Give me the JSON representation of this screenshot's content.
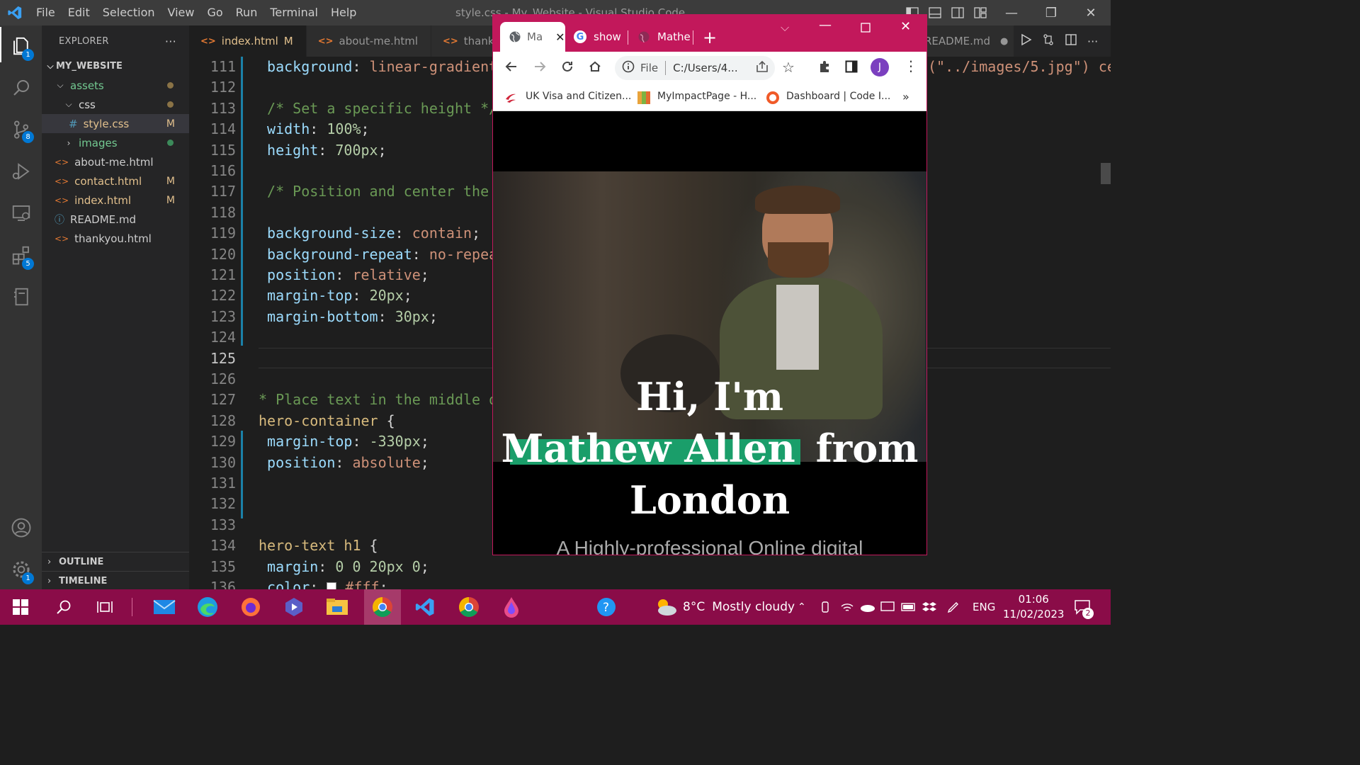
{
  "menubar": {
    "items": [
      "File",
      "Edit",
      "Selection",
      "View",
      "Go",
      "Run",
      "Terminal",
      "Help"
    ],
    "window_title": "style.css - My_Website - Visual Studio Code"
  },
  "activity_bar": {
    "explorer_badge": "1",
    "source_control_badge": "8",
    "extensions_badge": "5",
    "settings_badge": "1"
  },
  "explorer": {
    "title": "EXPLORER",
    "more": "···",
    "root": "MY_WEBSITE",
    "items": [
      {
        "label": "assets",
        "mark": "●"
      },
      {
        "label": "css",
        "mark": "●"
      },
      {
        "label": "style.css",
        "mark": "M",
        "icon": "#"
      },
      {
        "label": "images",
        "mark": "●"
      },
      {
        "label": "about-me.html",
        "mark": ""
      },
      {
        "label": "contact.html",
        "mark": "M"
      },
      {
        "label": "index.html",
        "mark": "M"
      },
      {
        "label": "README.md",
        "mark": ""
      },
      {
        "label": "thankyou.html",
        "mark": ""
      }
    ],
    "outline": "OUTLINE",
    "timeline": "TIMELINE"
  },
  "tabs": [
    {
      "label": "index.html",
      "mark": "M"
    },
    {
      "label": "about-me.html",
      "mark": ""
    },
    {
      "label": "thanky",
      "mark": ""
    },
    {
      "label": "README.md",
      "mark": "●"
    }
  ],
  "code": {
    "line_numbers": [
      "111",
      "112",
      "113",
      "114",
      "115",
      "116",
      "117",
      "118",
      "119",
      "120",
      "121",
      "122",
      "123",
      "124",
      "125",
      "126",
      "127",
      "128",
      "129",
      "130",
      "131",
      "132",
      "133",
      "134",
      "135",
      "136"
    ],
    "right_overflow": "(\"../images/5.jpg\") ce"
  },
  "browser": {
    "tabs": [
      "Ma",
      "show",
      "Mathe"
    ],
    "new_tab": "+",
    "address_scheme": "File",
    "address_url": "C:/Users/4...",
    "avatar_letter": "J",
    "bookmarks": [
      "UK Visa and Citizen...",
      "MyImpactPage - H...",
      "Dashboard | Code I..."
    ],
    "bookmarks_more": "»",
    "hero_line1": "Hi, I'm",
    "hero_name": "Mathew Allen",
    "hero_from": "from",
    "hero_line3": "London",
    "subtitle": "A Highly-professional Online digital"
  },
  "taskbar": {
    "weather_temp": "8°C",
    "weather_text": "Mostly cloudy",
    "language": "ENG",
    "time": "01:06",
    "date": "11/02/2023",
    "notifications": "2"
  }
}
